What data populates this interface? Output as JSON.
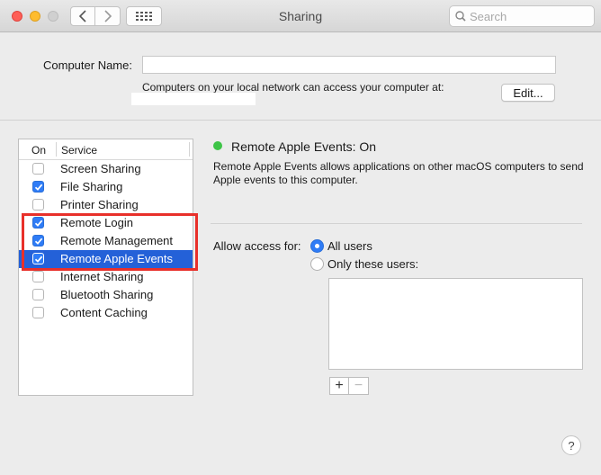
{
  "window": {
    "title": "Sharing"
  },
  "toolbar": {
    "search_placeholder": "Search",
    "grid_icon": "grid-icon",
    "back_icon": "chevron-left-icon",
    "forward_icon": "chevron-right-icon"
  },
  "computer_name": {
    "label": "Computer Name:",
    "value": "",
    "note": "Computers on your local network can access your computer at:",
    "edit_label": "Edit..."
  },
  "services": {
    "header_on": "On",
    "header_service": "Service",
    "items": [
      {
        "label": "Screen Sharing",
        "checked": false
      },
      {
        "label": "File Sharing",
        "checked": true
      },
      {
        "label": "Printer Sharing",
        "checked": false
      },
      {
        "label": "Remote Login",
        "checked": true
      },
      {
        "label": "Remote Management",
        "checked": true
      },
      {
        "label": "Remote Apple Events",
        "checked": true,
        "selected": true
      },
      {
        "label": "Internet Sharing",
        "checked": false
      },
      {
        "label": "Bluetooth Sharing",
        "checked": false
      },
      {
        "label": "Content Caching",
        "checked": false
      }
    ]
  },
  "detail": {
    "status": "Remote Apple Events: On",
    "status_color": "#3ec447",
    "description": "Remote Apple Events allows applications on other macOS computers to send Apple events to this computer.",
    "allow_label": "Allow access for:",
    "option_all": "All users",
    "option_only": "Only these users:",
    "selected_option": "All users",
    "plus": "+",
    "minus": "−"
  },
  "help_label": "?",
  "colors": {
    "accent": "#2f7cf6",
    "selection": "#2461d8",
    "annotation": "#e8302a"
  }
}
